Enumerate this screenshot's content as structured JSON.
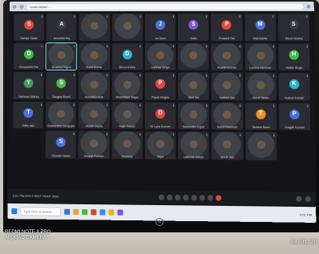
{
  "photo": {
    "subject": "Video conference gallery view",
    "background_color": "#c9c7c4",
    "screen_color": "#151519"
  },
  "browser": {
    "url_text": "zoom.us/wc/…"
  },
  "meeting": {
    "name_text": "3:01 PM  5TH FIRST YEAR 2020",
    "controls": [
      {
        "icon": "mic-icon"
      },
      {
        "icon": "video-icon"
      },
      {
        "icon": "participants-icon"
      },
      {
        "icon": "chat-icon"
      },
      {
        "icon": "share-icon"
      },
      {
        "icon": "record-icon"
      },
      {
        "icon": "reactions-icon"
      },
      {
        "icon": "end-call-icon",
        "color": "#e0463c"
      }
    ]
  },
  "tiles": [
    {
      "name": "Saniya Yadav",
      "type": "avatar",
      "color": "#e4473d",
      "letter": "S"
    },
    {
      "name": "Anushka Raj",
      "type": "avatar",
      "color": "#3a3b40",
      "letter": "A"
    },
    {
      "name": "",
      "type": "camera"
    },
    {
      "name": "",
      "type": "camera"
    },
    {
      "name": "Jai Sane",
      "type": "avatar",
      "color": "#4a6fe0",
      "letter": "J"
    },
    {
      "name": "Salla",
      "type": "avatar",
      "color": "#7c57d6",
      "letter": "S"
    },
    {
      "name": "Prasanti Rai",
      "type": "avatar",
      "color": "#e4473d",
      "letter": "P"
    },
    {
      "name": "Mali Mehta",
      "type": "avatar",
      "color": "#4a6fe0",
      "letter": "M"
    },
    {
      "name": "Shruti Shukla",
      "type": "avatar",
      "color": "#3a3b40",
      "letter": "S"
    },
    {
      "name": "Deepanshi Pal",
      "type": "avatar",
      "color": "#47b84e",
      "letter": "D"
    },
    {
      "name": "Bhawna Rajput",
      "type": "camera",
      "active": true
    },
    {
      "name": "Rohit Kumar",
      "type": "camera"
    },
    {
      "name": "Dhruv Kohra",
      "type": "avatar",
      "color": "#2bb3c9",
      "letter": "D"
    },
    {
      "name": "Vaibhav Singh",
      "type": "camera"
    },
    {
      "name": "",
      "type": "camera"
    },
    {
      "name": "Ananth Kumari",
      "type": "camera"
    },
    {
      "name": "Lumnia Kanchan",
      "type": "camera"
    },
    {
      "name": "Hrithik Singh",
      "type": "avatar",
      "color": "#47b84e",
      "letter": "H"
    },
    {
      "name": "Yashnavi Mishra",
      "type": "avatar",
      "color": "#3d9c59",
      "letter": "Y"
    },
    {
      "name": "Sangita Bharti",
      "type": "avatar",
      "color": "#47b84e",
      "letter": "S"
    },
    {
      "name": "Anmolika Arati",
      "type": "camera"
    },
    {
      "name": "Shashikant Sagar",
      "type": "camera"
    },
    {
      "name": "Payal Singha",
      "type": "avatar",
      "color": "#e4473d",
      "letter": "P"
    },
    {
      "name": "Abhi Sai",
      "type": "camera"
    },
    {
      "name": "Saffulel Ajai",
      "type": "camera"
    },
    {
      "name": "Shruti Yadav",
      "type": "camera"
    },
    {
      "name": "Kushal Kumari",
      "type": "avatar",
      "color": "#2bb3c9",
      "letter": "K"
    },
    {
      "name": "Trifla Jain",
      "type": "avatar",
      "color": "#4a6fe0",
      "letter": "T"
    },
    {
      "name": "Sudhanshu Sengupta",
      "type": "camera"
    },
    {
      "name": "Shubh Gupta",
      "type": "camera"
    },
    {
      "name": "Rajiv Tobool",
      "type": "camera"
    },
    {
      "name": "Dr Lyria Kumari",
      "type": "avatar",
      "color": "#e4473d",
      "letter": "D"
    },
    {
      "name": "Mahendra Jogan",
      "type": "camera"
    },
    {
      "name": "Nandi Ranimoti",
      "type": "camera"
    },
    {
      "name": "Tanisha Bauri",
      "type": "avatar",
      "color": "#e88f25",
      "letter": "T"
    },
    {
      "name": "Pragati Kumari",
      "type": "avatar",
      "color": "#4a6fe0",
      "letter": "P"
    },
    {
      "name": "",
      "type": "empty"
    },
    {
      "name": "Shanthi Yadav",
      "type": "avatar",
      "color": "#4a6fe0",
      "letter": "S"
    },
    {
      "name": "Srinjayi Roshan",
      "type": "camera"
    },
    {
      "name": "Manisha",
      "type": "camera"
    },
    {
      "name": "Riya",
      "type": "camera"
    },
    {
      "name": "Lakhmik Adhya",
      "type": "camera"
    },
    {
      "name": "Shruti Jain",
      "type": "camera"
    },
    {
      "name": "",
      "type": "camera"
    },
    {
      "name": "",
      "type": "empty"
    }
  ],
  "taskbar": {
    "search_text": "Type here to search",
    "tray_text": "3:01 PM",
    "apps": [
      "#2f7ad6",
      "#e8a33b",
      "#4bb349",
      "#d6452e",
      "#3a8be8",
      "#e2b720",
      "#7c57d6"
    ]
  },
  "laptop": {
    "brand_mark": "hp"
  },
  "watermark": {
    "line1": "REDMI NOTE 8 PRO",
    "line2": "AI QUAD CAMERA"
  },
  "timestamp": "04/01/20"
}
